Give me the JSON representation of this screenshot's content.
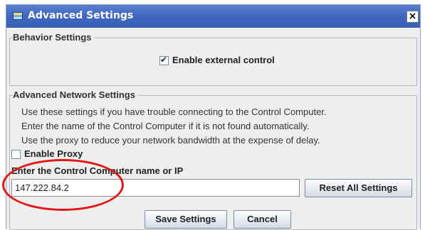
{
  "window": {
    "title": "Advanced Settings",
    "close_glyph": "×"
  },
  "behavior": {
    "group_label": "Behavior Settings",
    "enable_external_control": {
      "label": "Enable external control",
      "checked": true
    }
  },
  "network": {
    "group_label": "Advanced Network Settings",
    "info_lines": [
      "Use these settings if you have trouble connecting to the Control Computer.",
      "Enter the name of the Control Computer if it is not found automatically.",
      "Use the proxy to reduce your network bandwidth at the expense of delay."
    ],
    "enable_proxy": {
      "label": "Enable Proxy",
      "checked": false
    },
    "computer_field": {
      "label": "Enter the Control Computer name or IP",
      "value": "147.222.84.2"
    },
    "reset_button": "Reset All Settings"
  },
  "footer": {
    "save_button": "Save Settings",
    "cancel_button": "Cancel"
  },
  "colors": {
    "titlebar": "#3f67c1",
    "annotation": "#e01818"
  }
}
